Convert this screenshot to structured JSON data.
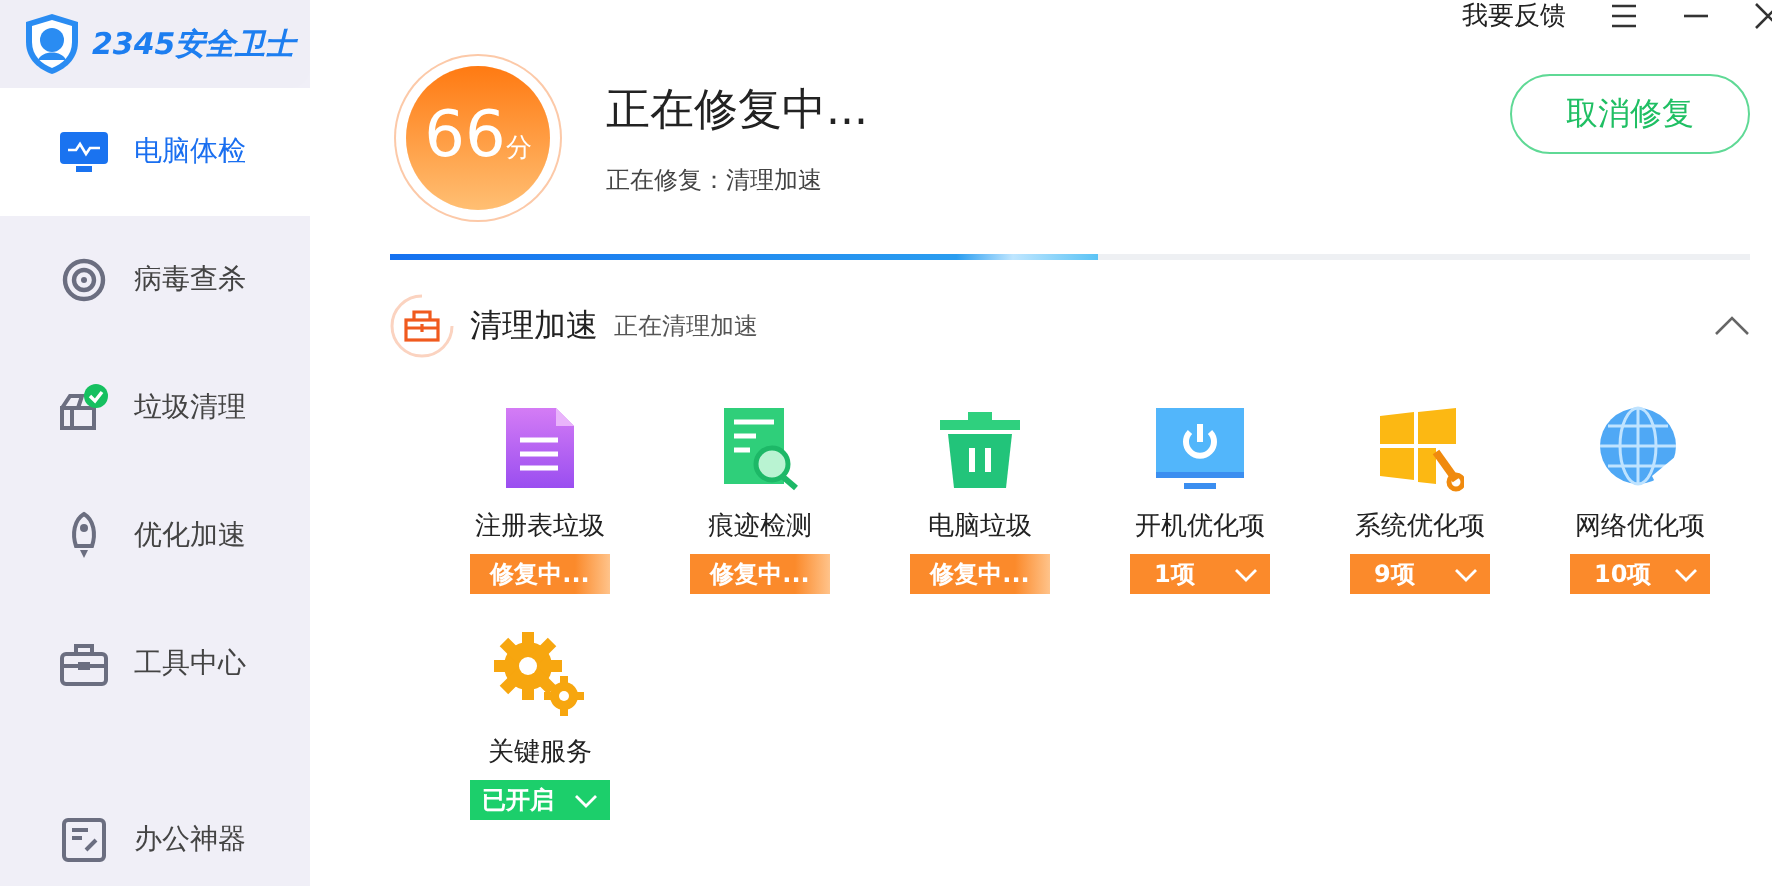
{
  "app": {
    "logo_text": "2345安全卫士"
  },
  "sidebar": {
    "items": [
      {
        "label": "电脑体检",
        "selected": true
      },
      {
        "label": "病毒查杀",
        "selected": false
      },
      {
        "label": "垃圾清理",
        "selected": false
      },
      {
        "label": "优化加速",
        "selected": false
      },
      {
        "label": "工具中心",
        "selected": false
      },
      {
        "label": "办公神器",
        "selected": false
      }
    ]
  },
  "titlebar": {
    "feedback": "我要反馈"
  },
  "status": {
    "score": "66",
    "score_unit": "分",
    "title": "正在修复中...",
    "subtitle": "正在修复：清理加速",
    "cancel_button": "取消修复",
    "progress": {
      "level": 0.52
    }
  },
  "section": {
    "title": "清理加速",
    "subtitle": "正在清理加速",
    "expanded": true,
    "items": [
      {
        "label": "注册表垃圾",
        "kind": "repairing",
        "status": "修复中..."
      },
      {
        "label": "痕迹检测",
        "kind": "repairing",
        "status": "修复中..."
      },
      {
        "label": "电脑垃圾",
        "kind": "repairing",
        "status": "修复中..."
      },
      {
        "label": "开机优化项",
        "kind": "count",
        "status": "1项"
      },
      {
        "label": "系统优化项",
        "kind": "count",
        "status": "9项"
      },
      {
        "label": "网络优化项",
        "kind": "count",
        "status": "10项"
      },
      {
        "label": "关键服务",
        "kind": "enabled",
        "status": "已开启"
      }
    ]
  }
}
